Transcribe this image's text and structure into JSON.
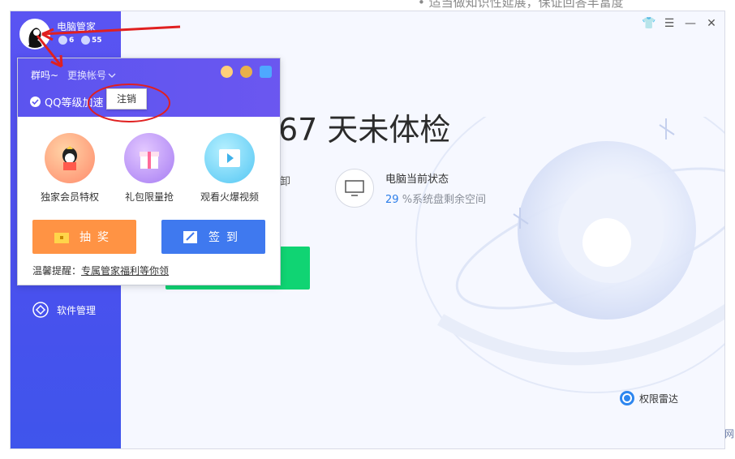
{
  "background": {
    "top_text": "• 适当做知识性延展，保证回答丰富度",
    "corner_text": "网"
  },
  "sidebar": {
    "app_name": "电脑管家",
    "levels": [
      "6",
      "55"
    ],
    "items": [
      {
        "label": "软件管理",
        "icon": "software-manager-icon"
      }
    ]
  },
  "window_controls": {
    "icons": [
      "skin-icon",
      "menu-icon",
      "minimize-icon",
      "close-icon"
    ],
    "glyphs": [
      "👕",
      "☰",
      "—",
      "✕"
    ]
  },
  "main": {
    "title": "67 天未体检",
    "partial_label": "卸",
    "status": {
      "title": "电脑当前状态",
      "value": "29",
      "suffix": "%系统盘剩余空间"
    },
    "radar_label": "权限雷达"
  },
  "popup": {
    "user": "群吗~",
    "switch_account": "更换帐号",
    "accelerate": "QQ等级加速",
    "tooltip": "注销",
    "features": [
      {
        "label": "独家会员特权",
        "icon": "qq-penguin-gift-icon"
      },
      {
        "label": "礼包限量抢",
        "icon": "gift-box-icon"
      },
      {
        "label": "观看火爆视频",
        "icon": "video-play-icon"
      }
    ],
    "lottery_button": "抽奖",
    "signin_button": "签到",
    "notice_prefix": "温馨提醒：",
    "notice_link": "专属管家福利等你领"
  },
  "colors": {
    "sidebar": "#4b50ee",
    "accent_blue": "#3f79ef",
    "lottery_orange": "#ff9344",
    "check_green": "#10d473",
    "annotation_red": "#e02020"
  }
}
